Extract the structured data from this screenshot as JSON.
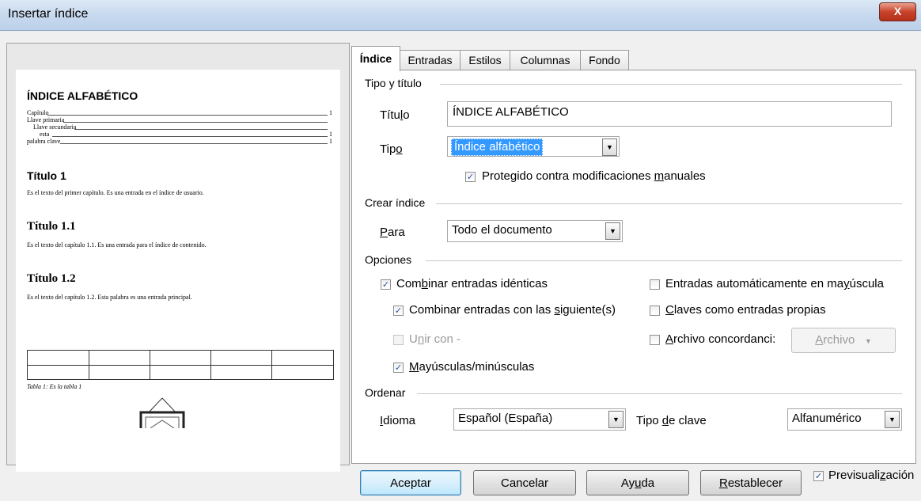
{
  "window": {
    "title": "Insertar índice",
    "close": "X"
  },
  "preview": {
    "index_title": "ÍNDICE ALFABÉTICO",
    "entries": [
      {
        "text": "Capítulo",
        "page": "1"
      },
      {
        "text": "Llave primaria",
        "page": ""
      },
      {
        "text": "Llave secundaria",
        "page": ""
      },
      {
        "text": "esta",
        "page": "1"
      },
      {
        "text": "palabra clave",
        "page": "1"
      }
    ],
    "h1": "Título 1",
    "p1": "Es el texto del primer capítulo. Es una entrada en el índice de usuario.",
    "h2": "Título 1.1",
    "p2": "Es el texto del capítulo 1.1. Es una entrada para el índice de contenido.",
    "h3": "Título 1.2",
    "p3": "Es el texto del capítulo 1.2. Esta palabra es una entrada principal.",
    "table_caption": "Tabla 1: Es la tabla 1"
  },
  "tabs": [
    "Índice",
    "Entradas",
    "Estilos",
    "Columnas",
    "Fondo"
  ],
  "tipo_titulo": {
    "section": "Tipo y título",
    "titulo_label_pre": "Títu",
    "titulo_label_u": "l",
    "titulo_label_post": "o",
    "titulo_value": "ÍNDICE ALFABÉTICO",
    "tipo_label_pre": "Tip",
    "tipo_label_u": "o",
    "tipo_value": "Índice alfabético",
    "protegido_pre": "Protegido contra modificaciones ",
    "protegido_u": "m",
    "protegido_post": "anuales"
  },
  "crear": {
    "section": "Crear índice",
    "para_u": "P",
    "para_post": "ara",
    "para_value": "Todo el documento"
  },
  "opciones": {
    "section": "Opciones",
    "combinar_pre": "Com",
    "combinar_u": "b",
    "combinar_post": "inar entradas idénticas",
    "combinar_sig_pre": "Combinar entradas con las ",
    "combinar_sig_u": "s",
    "combinar_sig_post": "iguiente(s)",
    "unir_pre": "U",
    "unir_u": "n",
    "unir_post": "ir con -",
    "mayus_u": "M",
    "mayus_post": "ayúsculas/minúsculas",
    "auto_pre": "Entradas automáticamente en ma",
    "auto_u": "y",
    "auto_post": "úscula",
    "claves_u": "C",
    "claves_post": "laves como entradas propias",
    "archivo_u": "A",
    "archivo_post": "rchivo concordanci:",
    "archivo_btn_u": "A",
    "archivo_btn_post": "rchivo"
  },
  "ordenar": {
    "section": "Ordenar",
    "idioma_u": "I",
    "idioma_post": "dioma",
    "idioma_value": "Español (España)",
    "tipo_clave_pre": "Tipo ",
    "tipo_clave_u": "d",
    "tipo_clave_post": "e clave",
    "tipo_clave_value": "Alfanumérico"
  },
  "buttons": {
    "aceptar": "Aceptar",
    "cancelar": "Cancelar",
    "ayuda_pre": "Ay",
    "ayuda_u": "u",
    "ayuda_post": "da",
    "restablecer_u": "R",
    "restablecer_post": "establecer",
    "preview_pre": "Previsuali",
    "preview_u": "z",
    "preview_post": "ación"
  },
  "checks": {
    "checked": "✓"
  },
  "colors": {
    "selection": "#3399ff",
    "default_button_border": "#3c7fb1"
  }
}
